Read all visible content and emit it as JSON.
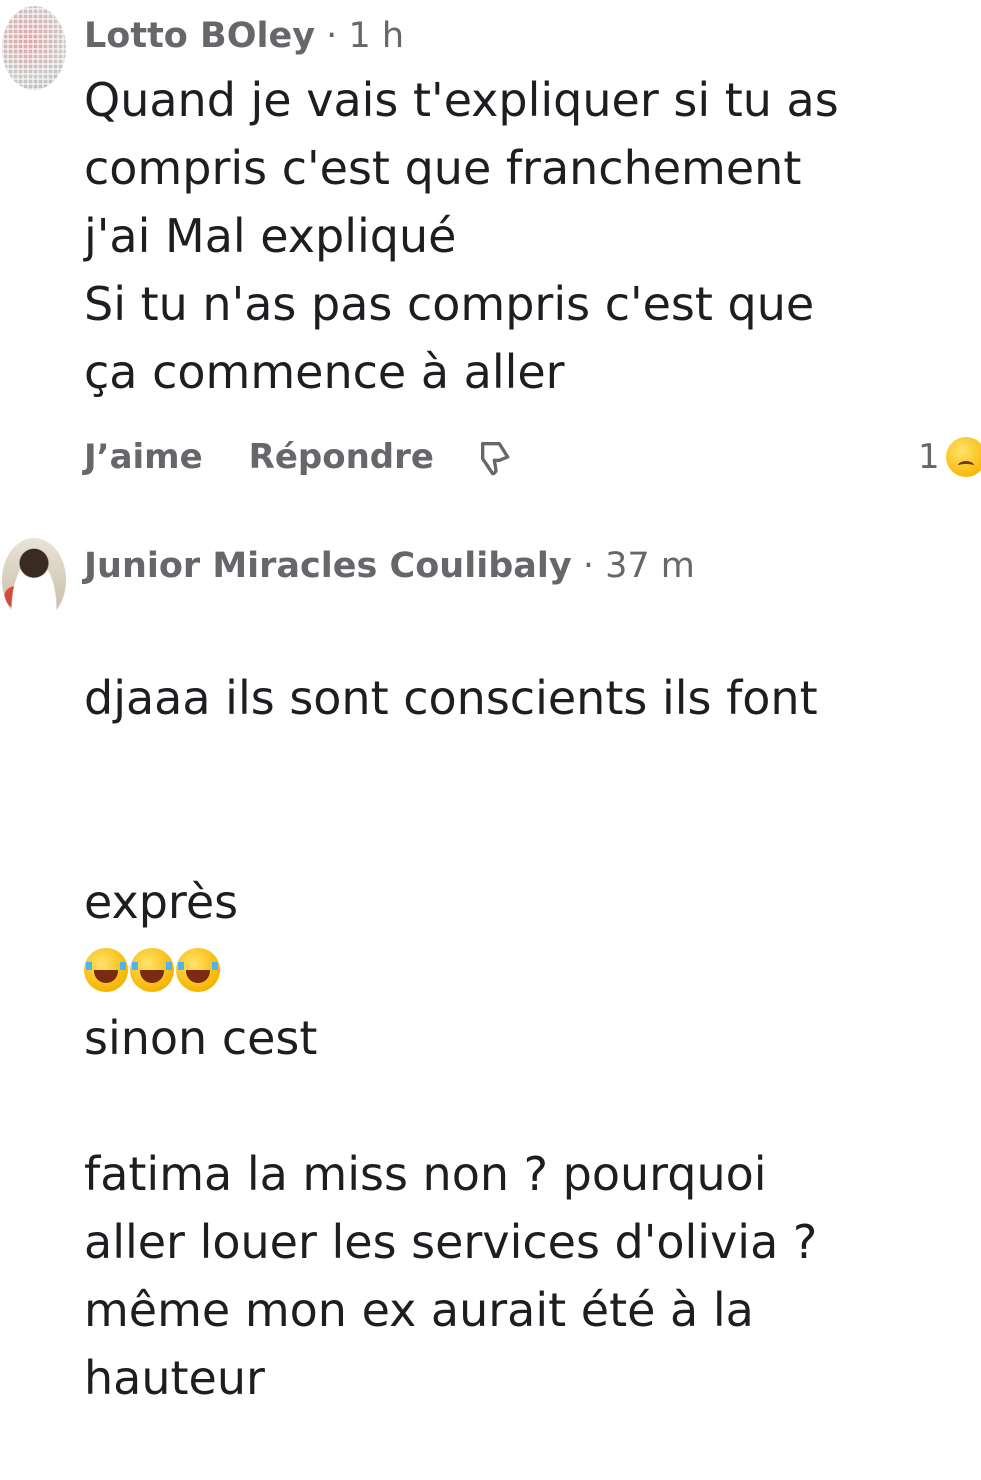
{
  "comments": [
    {
      "author": "Lotto BOley",
      "separator": "·",
      "time": "1 h",
      "text": "Quand je vais t'expliquer si tu as\ncompris c'est que franchement\nj'ai Mal expliqué\nSi tu n'as pas compris c'est que\nça commence à aller",
      "actions": {
        "like": "J’aime",
        "reply": "Répondre"
      },
      "reaction_count": "1"
    },
    {
      "author": "Junior Miracles Coulibaly",
      "separator": "·",
      "time": "37 m",
      "text_line1": "djaaa ils sont conscients ils font",
      "text_line2_before": "exprès",
      "text_line2_after": "sinon cest",
      "text_rest": "fatima la miss non ? pourquoi\naller louer les services d'olivia ?\nmême mon ex aurait été à la\nhauteur"
    }
  ],
  "icons": {
    "dislike": "thumbs-down-icon",
    "emoji_joy": "face-with-tears-of-joy-icon",
    "emoji_rofl": "rolling-on-the-floor-laughing-icon",
    "reaction": "sad-face-icon"
  },
  "colors": {
    "meta": "#65676b",
    "text": "#1c1e21"
  }
}
